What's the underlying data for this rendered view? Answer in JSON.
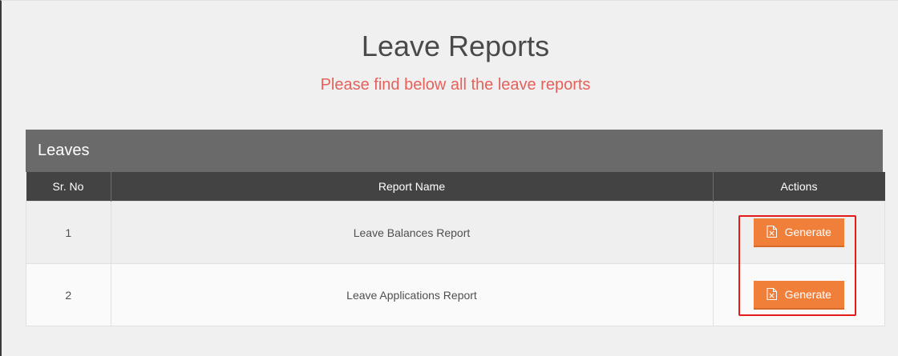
{
  "header": {
    "title": "Leave Reports",
    "subtitle": "Please find below all the leave reports"
  },
  "panel": {
    "heading": "Leaves"
  },
  "table": {
    "columns": [
      "Sr. No",
      "Report Name",
      "Actions"
    ],
    "rows": [
      {
        "sr_no": "1",
        "report_name": "Leave Balances Report",
        "action_label": "Generate",
        "action_icon": "excel-file-icon"
      },
      {
        "sr_no": "2",
        "report_name": "Leave Applications Report",
        "action_label": "Generate",
        "action_icon": "excel-file-icon"
      }
    ]
  },
  "colors": {
    "accent_button": "#f07f3a",
    "subtitle": "#e5615a",
    "panel_heading": "#6a6a6a",
    "table_header": "#434343",
    "highlight": "#e41b1b"
  }
}
